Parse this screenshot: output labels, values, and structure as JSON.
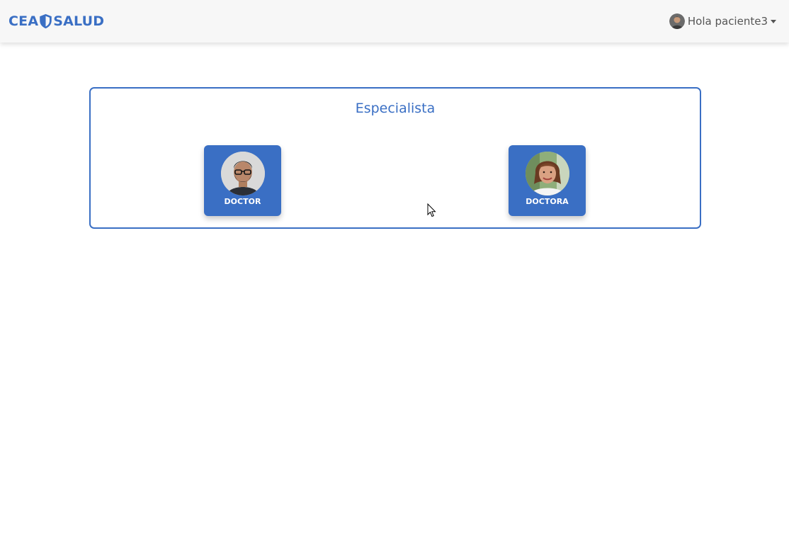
{
  "navbar": {
    "brand_left": "CEA",
    "brand_right": "SALUD",
    "brand_icon": "shield-icon",
    "user_greeting": "Hola paciente3",
    "user_menu_icon": "caret-down-icon"
  },
  "panel": {
    "title": "Especialista",
    "cards": [
      {
        "label": "DOCTOR",
        "photo": "male-doctor-photo"
      },
      {
        "label": "DOCTORA",
        "photo": "female-doctor-photo"
      }
    ]
  },
  "colors": {
    "brand": "#3a6fc4",
    "navbar_bg": "#f7f7f7",
    "card_bg": "#3a6fc4",
    "card_text": "#ffffff",
    "user_text": "#555555"
  }
}
